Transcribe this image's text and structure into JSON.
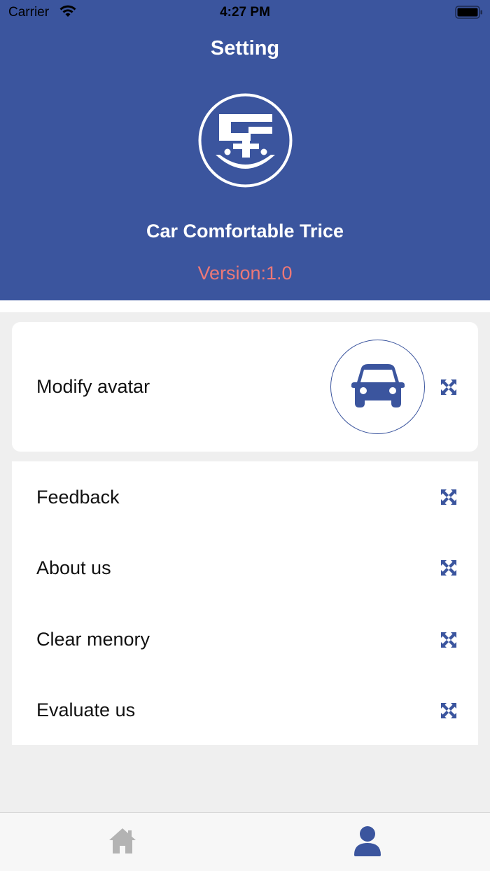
{
  "status_bar": {
    "carrier": "Carrier",
    "time": "4:27 PM"
  },
  "header": {
    "title": "Setting",
    "app_name": "Car Comfortable Trice",
    "version": "Version:1.0",
    "logo_icon": "app-logo-icon"
  },
  "avatar_row": {
    "label": "Modify avatar",
    "avatar_icon": "car-icon"
  },
  "settings_list": [
    {
      "label": "Feedback"
    },
    {
      "label": "About us"
    },
    {
      "label": "Clear menory"
    },
    {
      "label": "Evaluate us"
    }
  ],
  "tab_bar": {
    "tabs": [
      {
        "icon": "home-icon",
        "active": false
      },
      {
        "icon": "person-icon",
        "active": true
      }
    ]
  },
  "colors": {
    "primary": "#3b559e",
    "version_text": "#ec7877",
    "background": "#efefef",
    "inactive_tab": "#b3b3b3"
  }
}
